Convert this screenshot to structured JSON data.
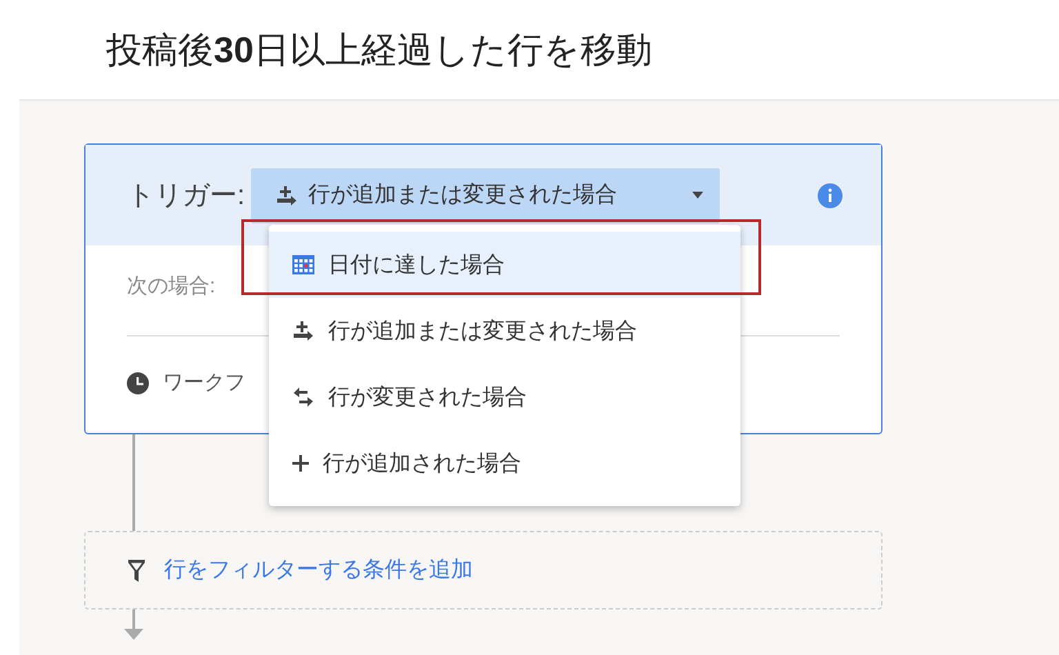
{
  "title": "投稿後**30**日以上経過した行を移動",
  "trigger": {
    "label": "トリガー:",
    "value": "行が追加または変更された場合",
    "expanded": true
  },
  "condition_label": "次の場合:",
  "schedule_label": "ワークフ",
  "menu": [
    {
      "kind": "calendar",
      "label": "日付に達した場合",
      "selected": true,
      "highlighted": true
    },
    {
      "kind": "add-change",
      "label": "行が追加または変更された場合",
      "selected": false,
      "highlighted": false
    },
    {
      "kind": "change",
      "label": "行が変更された場合",
      "selected": false,
      "highlighted": false
    },
    {
      "kind": "add",
      "label": "行が追加された場合",
      "selected": false,
      "highlighted": false
    }
  ],
  "filter": {
    "label": "行をフィルターする条件を追加"
  }
}
